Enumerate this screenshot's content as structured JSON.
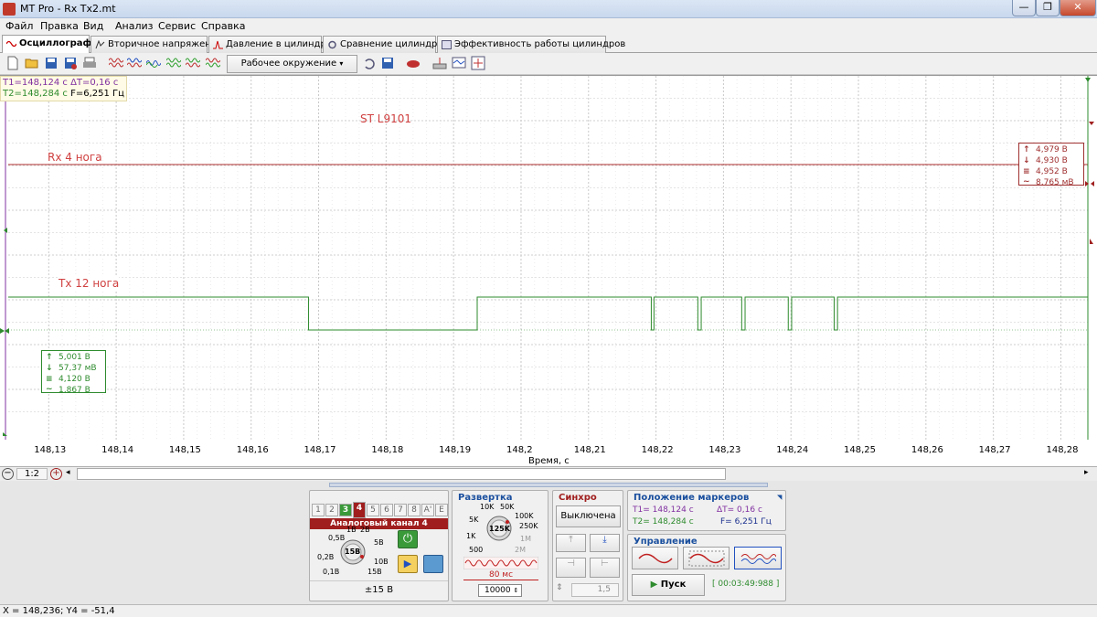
{
  "window": {
    "title": "MT Pro - Rx Tx2.mt",
    "minimize": "—",
    "restore": "❐",
    "close": "✕"
  },
  "menu": [
    "Файл",
    "Правка",
    "Вид",
    "Анализ",
    "Сервис",
    "Справка"
  ],
  "tabs": [
    {
      "label": "Осциллограф",
      "active": true
    },
    {
      "label": "Вторичное напряжение"
    },
    {
      "label": "Давление в цилиндре"
    },
    {
      "label": "Сравнение цилиндров"
    },
    {
      "label": "Эффективность работы цилиндров"
    }
  ],
  "toolbar": {
    "environment_label": "Рабочее окружение"
  },
  "cursor_info": {
    "t1": "T1=148,124 с",
    "dt": "ΔT=0,16 с",
    "t2": "T2=148,284 с",
    "f": "F=6,251 Гц"
  },
  "annotations": {
    "chip": "ST L9101",
    "rx_label": "Rx 4 нога",
    "tx_label": "Tx 12 нога"
  },
  "rx_measure": {
    "max": "4,979 В",
    "min": "4,930 В",
    "avg": "4,952 В",
    "rms": "8,765 мВ"
  },
  "tx_measure": {
    "max": "5,001 В",
    "min": "57,37 мВ",
    "avg": "4,120 В",
    "rms": "1,867 В"
  },
  "xaxis": {
    "title": "Время, с",
    "ticks": [
      "148,13",
      "148,14",
      "148,15",
      "148,16",
      "148,17",
      "148,18",
      "148,19",
      "148,2",
      "148,21",
      "148,22",
      "148,23",
      "148,24",
      "148,25",
      "148,26",
      "148,27",
      "148,28"
    ]
  },
  "chart_data": {
    "type": "line",
    "xlabel": "Время, с",
    "xlim": [
      148.124,
      148.284
    ],
    "series": [
      {
        "name": "Rx 4 нога",
        "color": "#b03030",
        "x": [
          148.124,
          148.284
        ],
        "y": [
          4.95,
          4.95
        ]
      },
      {
        "name": "Tx 12 нога",
        "color": "#2e8b2e",
        "edges": [
          [
            148.124,
            1
          ],
          [
            148.1685,
            0
          ],
          [
            148.1935,
            1
          ],
          [
            148.2193,
            0
          ],
          [
            148.2197,
            1
          ],
          [
            148.2262,
            0
          ],
          [
            148.2267,
            1
          ],
          [
            148.2327,
            0
          ],
          [
            148.2332,
            1
          ],
          [
            148.2396,
            0
          ],
          [
            148.2401,
            1
          ],
          [
            148.2464,
            0
          ],
          [
            148.2469,
            1
          ],
          [
            148.284,
            1
          ]
        ]
      }
    ]
  },
  "scroll": {
    "zoom_label": "1:2"
  },
  "channel_panel": {
    "tabs": [
      "1",
      "2",
      "3",
      "4",
      "5",
      "6",
      "7",
      "8̄",
      "A'",
      "E"
    ],
    "title": "Аналоговый канал 4",
    "knob_labels": [
      "0,5В",
      "1В",
      "2В",
      "5В",
      "0,2В",
      "10В",
      "0,1В",
      "15В",
      "15В"
    ],
    "range": "±15 В"
  },
  "sweep_panel": {
    "title": "Развертка",
    "knob_labels": [
      "10K",
      "50K",
      "5K",
      "100K",
      "1K",
      "250K",
      "500",
      "2M",
      "1M",
      "125K"
    ],
    "time": "80 мс",
    "points": "10000"
  },
  "sync_panel": {
    "title": "Синхро",
    "mode": "Выключена",
    "level": "1,5"
  },
  "markers_panel": {
    "title": "Положение маркеров",
    "t1": "T1= 148,124 с",
    "dt": "ΔT= 0,16 с",
    "t2": "T2= 148,284 с",
    "f": "F= 6,251 Гц"
  },
  "control_panel": {
    "title": "Управление",
    "start": "Пуск",
    "timer": "[ 00:03:49:988 ]"
  },
  "status": {
    "coords": "X = 148,236; Y4 = -51,4"
  }
}
